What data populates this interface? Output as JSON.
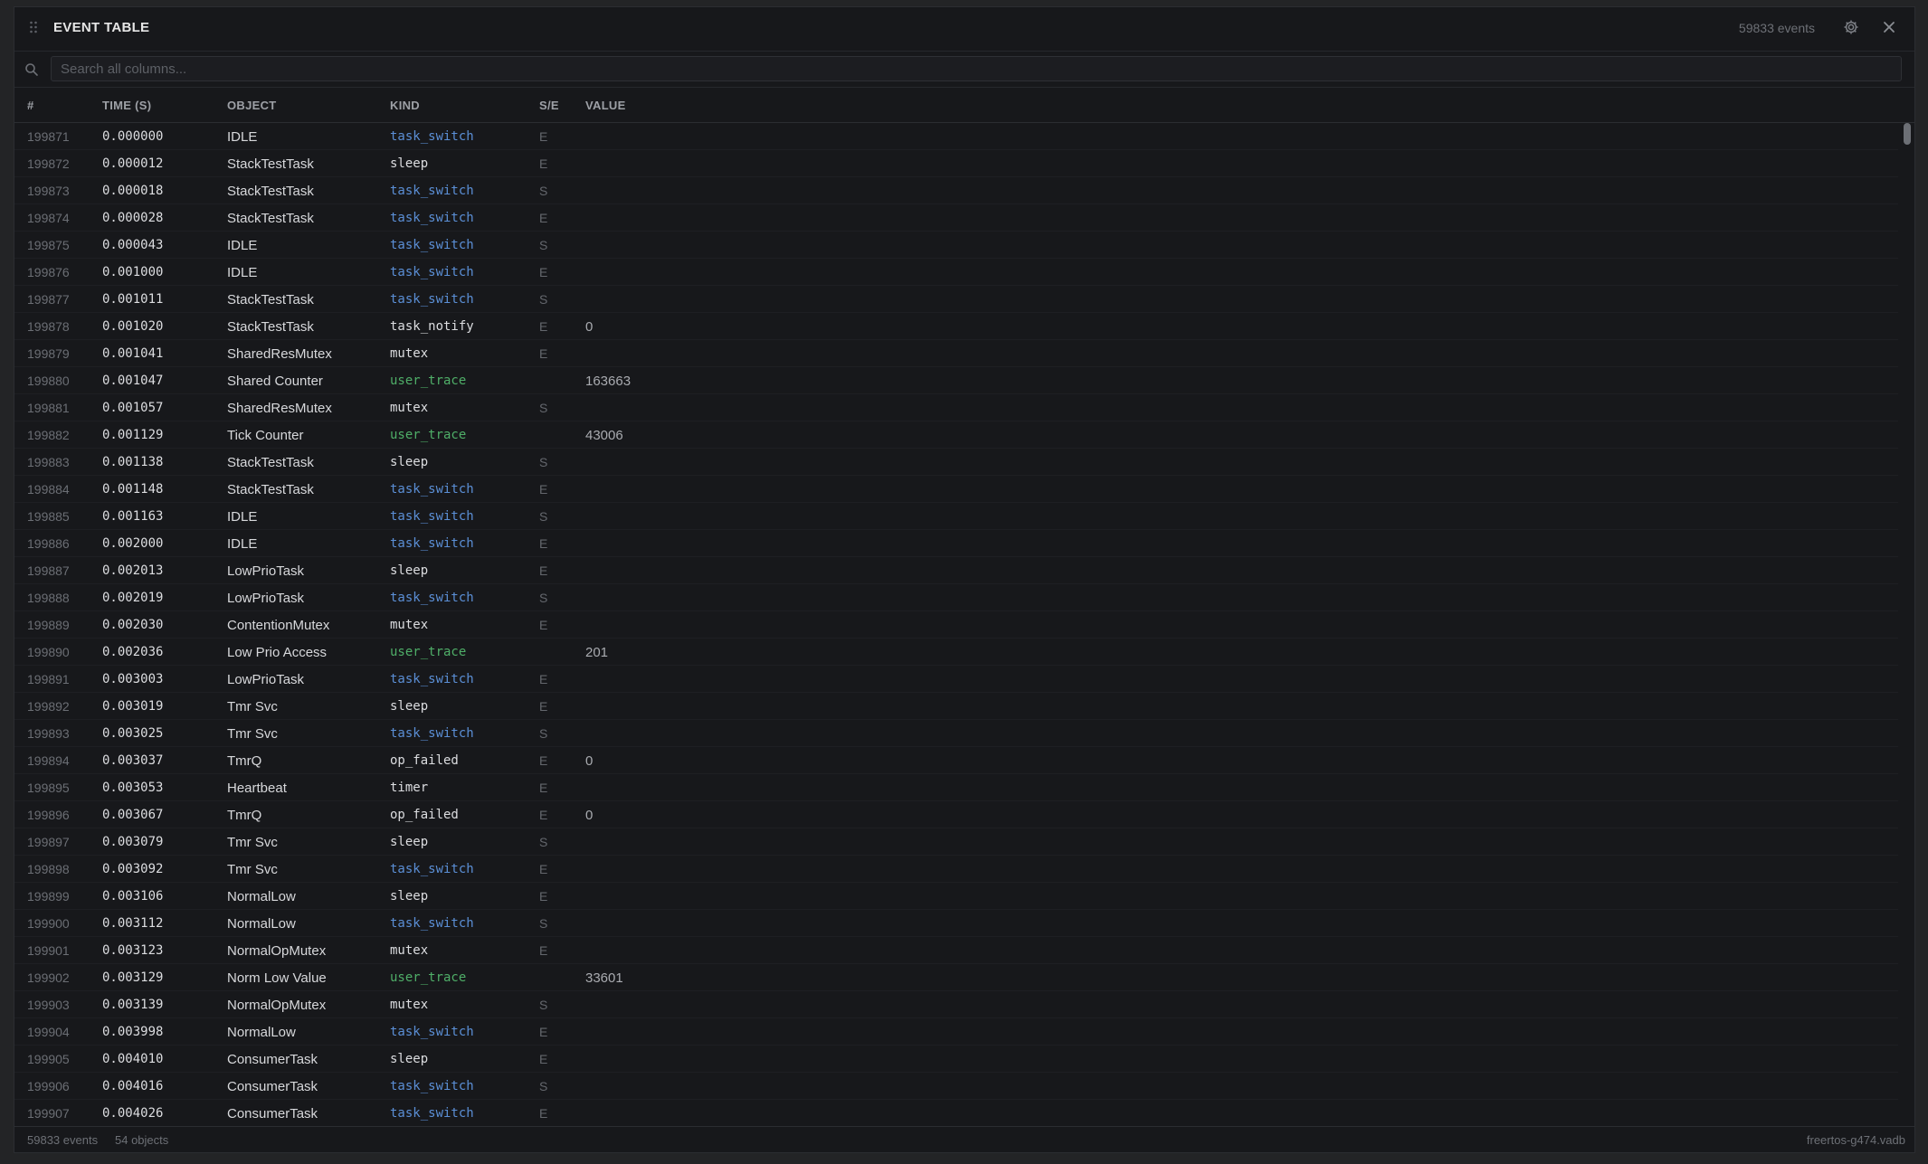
{
  "header": {
    "title": "EVENT TABLE",
    "count": "59833 events",
    "icons": [
      "drag-handle-icon",
      "gear-icon",
      "close-icon"
    ]
  },
  "search": {
    "placeholder": "Search all columns...",
    "value": ""
  },
  "columns": [
    "#",
    "TIME (S)",
    "OBJECT",
    "KIND",
    "S/E",
    "VALUE"
  ],
  "colors": {
    "task_switch": "#5b8fd6",
    "user_trace": "#4fae68",
    "default_kind": "#dcdde0"
  },
  "rows": [
    [
      "199871",
      "0.000000",
      "IDLE",
      "task_switch",
      "E",
      ""
    ],
    [
      "199872",
      "0.000012",
      "StackTestTask",
      "sleep",
      "E",
      ""
    ],
    [
      "199873",
      "0.000018",
      "StackTestTask",
      "task_switch",
      "S",
      ""
    ],
    [
      "199874",
      "0.000028",
      "StackTestTask",
      "task_switch",
      "E",
      ""
    ],
    [
      "199875",
      "0.000043",
      "IDLE",
      "task_switch",
      "S",
      ""
    ],
    [
      "199876",
      "0.001000",
      "IDLE",
      "task_switch",
      "E",
      ""
    ],
    [
      "199877",
      "0.001011",
      "StackTestTask",
      "task_switch",
      "S",
      ""
    ],
    [
      "199878",
      "0.001020",
      "StackTestTask",
      "task_notify",
      "E",
      "0"
    ],
    [
      "199879",
      "0.001041",
      "SharedResMutex",
      "mutex",
      "E",
      ""
    ],
    [
      "199880",
      "0.001047",
      "Shared Counter",
      "user_trace",
      "",
      "163663"
    ],
    [
      "199881",
      "0.001057",
      "SharedResMutex",
      "mutex",
      "S",
      ""
    ],
    [
      "199882",
      "0.001129",
      "Tick Counter",
      "user_trace",
      "",
      "43006"
    ],
    [
      "199883",
      "0.001138",
      "StackTestTask",
      "sleep",
      "S",
      ""
    ],
    [
      "199884",
      "0.001148",
      "StackTestTask",
      "task_switch",
      "E",
      ""
    ],
    [
      "199885",
      "0.001163",
      "IDLE",
      "task_switch",
      "S",
      ""
    ],
    [
      "199886",
      "0.002000",
      "IDLE",
      "task_switch",
      "E",
      ""
    ],
    [
      "199887",
      "0.002013",
      "LowPrioTask",
      "sleep",
      "E",
      ""
    ],
    [
      "199888",
      "0.002019",
      "LowPrioTask",
      "task_switch",
      "S",
      ""
    ],
    [
      "199889",
      "0.002030",
      "ContentionMutex",
      "mutex",
      "E",
      ""
    ],
    [
      "199890",
      "0.002036",
      "Low Prio Access",
      "user_trace",
      "",
      "201"
    ],
    [
      "199891",
      "0.003003",
      "LowPrioTask",
      "task_switch",
      "E",
      ""
    ],
    [
      "199892",
      "0.003019",
      "Tmr Svc",
      "sleep",
      "E",
      ""
    ],
    [
      "199893",
      "0.003025",
      "Tmr Svc",
      "task_switch",
      "S",
      ""
    ],
    [
      "199894",
      "0.003037",
      "TmrQ",
      "op_failed",
      "E",
      "0"
    ],
    [
      "199895",
      "0.003053",
      "Heartbeat",
      "timer",
      "E",
      ""
    ],
    [
      "199896",
      "0.003067",
      "TmrQ",
      "op_failed",
      "E",
      "0"
    ],
    [
      "199897",
      "0.003079",
      "Tmr Svc",
      "sleep",
      "S",
      ""
    ],
    [
      "199898",
      "0.003092",
      "Tmr Svc",
      "task_switch",
      "E",
      ""
    ],
    [
      "199899",
      "0.003106",
      "NormalLow",
      "sleep",
      "E",
      ""
    ],
    [
      "199900",
      "0.003112",
      "NormalLow",
      "task_switch",
      "S",
      ""
    ],
    [
      "199901",
      "0.003123",
      "NormalOpMutex",
      "mutex",
      "E",
      ""
    ],
    [
      "199902",
      "0.003129",
      "Norm Low Value",
      "user_trace",
      "",
      "33601"
    ],
    [
      "199903",
      "0.003139",
      "NormalOpMutex",
      "mutex",
      "S",
      ""
    ],
    [
      "199904",
      "0.003998",
      "NormalLow",
      "task_switch",
      "E",
      ""
    ],
    [
      "199905",
      "0.004010",
      "ConsumerTask",
      "sleep",
      "E",
      ""
    ],
    [
      "199906",
      "0.004016",
      "ConsumerTask",
      "task_switch",
      "S",
      ""
    ],
    [
      "199907",
      "0.004026",
      "ConsumerTask",
      "task_switch",
      "E",
      ""
    ]
  ],
  "footer": {
    "events": "59833 events",
    "objects": "54 objects",
    "file": "freertos-g474.vadb"
  }
}
